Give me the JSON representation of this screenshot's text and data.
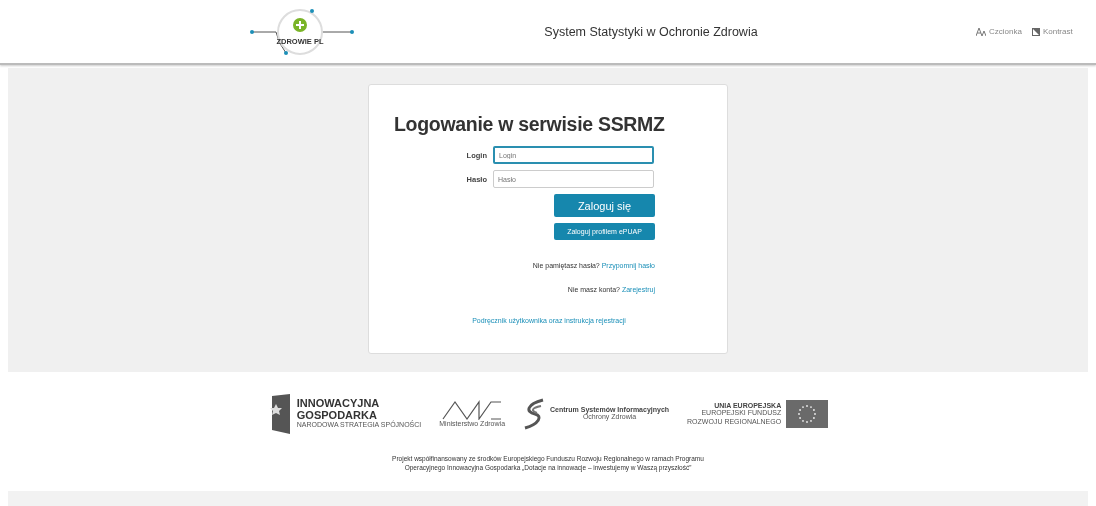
{
  "header": {
    "logo_text": "ZDROWIE PL",
    "title": "System Statystyki w Ochronie Zdrowia",
    "tools": [
      {
        "kind": "font",
        "label": "Czcionka"
      },
      {
        "kind": "contrast",
        "label": "Kontrast"
      }
    ]
  },
  "login": {
    "heading": "Logowanie w serwisie SSRMZ",
    "fields": [
      {
        "label": "Login",
        "placeholder": "Login",
        "focused": true
      },
      {
        "label": "Hasło",
        "placeholder": "Hasło",
        "focused": false
      }
    ],
    "buttons": [
      {
        "kind": "primary",
        "label": "Zaloguj się"
      },
      {
        "kind": "secondary",
        "label": "Zaloguj profilem ePUAP"
      }
    ],
    "links": [
      {
        "prefix": "Nie pamiętasz hasła?",
        "link": "Przypomnij hasło"
      },
      {
        "prefix": "Nie masz konta?",
        "link": "Zarejestruj"
      },
      {
        "link": "Podręcznik użytkownika oraz instrukcja rejestracji"
      }
    ]
  },
  "footer": {
    "logos": [
      {
        "kind": "ig",
        "lines": [
          "INNOWACYJNA",
          "GOSPODARKA"
        ],
        "sub": [
          "NARODOWA STRATEGIA SPÓJNOŚCI"
        ]
      },
      {
        "kind": "mz",
        "sub": [
          "Ministerstwo Zdrowia"
        ]
      },
      {
        "kind": "csioz",
        "lines": [
          "Centrum Systemów Informacyjnych"
        ],
        "sub": [
          "Ochrony Zdrowia"
        ]
      },
      {
        "kind": "ue",
        "lines": [
          "UNIA EUROPEJSKA"
        ],
        "sub": [
          "EUROPEJSKI FUNDUSZ",
          "ROZWOJU REGIONALNEGO"
        ]
      }
    ],
    "note": [
      "Projekt współfinansowany ze środków Europejskiego Funduszu Rozwoju Regionalnego w ramach Programu",
      "Operacyjnego Innowacyjna Gospodarka „Dotacje na innowacje – inwestujemy w Waszą przyszłość”"
    ]
  }
}
